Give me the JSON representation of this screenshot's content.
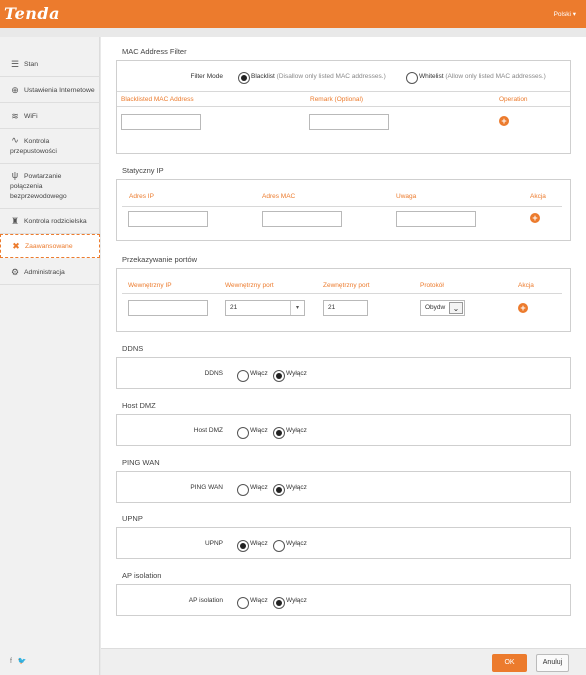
{
  "header": {
    "logo": "Tenda",
    "language": "Polski ▾"
  },
  "sidebar": {
    "items": [
      {
        "label": "Stan",
        "icon": "status-icon"
      },
      {
        "label": "Ustawienia Internetowe",
        "icon": "globe-icon"
      },
      {
        "label": "WiFi",
        "icon": "wifi-icon"
      },
      {
        "label_line1": "Kontrola",
        "label_line2": "przepustowości",
        "icon": "bandwidth-icon"
      },
      {
        "label_line1": "Powtarzanie",
        "label_line2": "połączenia",
        "label_line3": "bezprzewodowego",
        "icon": "repeater-icon"
      },
      {
        "label": "Kontrola rodzicielska",
        "icon": "parental-icon"
      },
      {
        "label": "Zaawansowane",
        "icon": "tools-icon",
        "active": true
      },
      {
        "label": "Administracja",
        "icon": "gear-icon"
      }
    ],
    "social": "f  🐦"
  },
  "mac_filter": {
    "title": "MAC Address Filter",
    "mode_label": "Filter Mode",
    "blacklist": "Blacklist",
    "blacklist_hint": "(Disallow only listed MAC addresses.)",
    "whitelist": "Whitelist",
    "whitelist_hint": "(Allow only listed MAC addresses.)",
    "selected": "blacklist",
    "col_mac": "Blacklisted MAC Address",
    "col_remark": "Remark (Optional)",
    "col_op": "Operation"
  },
  "static_ip": {
    "title": "Statyczny IP",
    "col_ip": "Adres IP",
    "col_mac": "Adres MAC",
    "col_note": "Uwaga",
    "col_action": "Akcja"
  },
  "port_forward": {
    "title": "Przekazywanie portów",
    "col_internal_ip": "Wewnętrzny IP",
    "col_internal_port": "Wewnętrzny port",
    "col_external_port": "Zewnętrzny port",
    "col_protocol": "Protokół",
    "col_action": "Akcja",
    "internal_port_value": "21",
    "external_port_value": "21",
    "protocol_value": "Obydw"
  },
  "ddns": {
    "title": "DDNS",
    "label": "DDNS",
    "on": "Włącz",
    "off": "Wyłącz",
    "selected": "off"
  },
  "dmz": {
    "title": "Host DMZ",
    "label": "Host DMZ",
    "on": "Włącz",
    "off": "Wyłącz",
    "selected": "off"
  },
  "ping": {
    "title": "PING WAN",
    "label": "PING WAN",
    "on": "Włącz",
    "off": "Wyłącz",
    "selected": "off"
  },
  "upnp": {
    "title": "UPNP",
    "label": "UPNP",
    "on": "Włącz",
    "off": "Wyłącz",
    "selected": "on"
  },
  "ap_isolation": {
    "title": "AP isolation",
    "label": "AP isolation",
    "on": "Włącz",
    "off": "Wyłącz",
    "selected": "off"
  },
  "footer": {
    "ok": "OK",
    "cancel": "Anuluj"
  },
  "colors": {
    "accent": "#ec7b2d"
  }
}
